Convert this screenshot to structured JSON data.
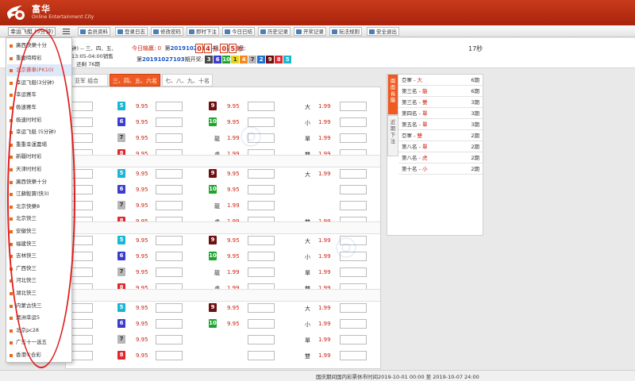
{
  "app": {
    "title": "富华",
    "subtitle": "Online Entertainment City"
  },
  "toolbar": {
    "lottery_select": "幸运飞艇 (5分钟)",
    "buttons": [
      "会员资料",
      "登录日志",
      "修改密码",
      "即时下注",
      "今日已结",
      "历史记录",
      "开奖记录",
      "玩法规则",
      "安全退出"
    ]
  },
  "info": {
    "partial_game": "钟) -- 三、四、五、",
    "time_range": "13:05-04:00销售",
    "remaining_draws": "还剩 76期",
    "today_result_label": "今日输赢:",
    "today_result_value": "0",
    "period_prefix": "第",
    "current_period": "20191027105",
    "period_suffix": "期, 距离封盘:",
    "countdown_digits": [
      "0",
      "4",
      "0",
      "5"
    ],
    "countdown_units": [
      "分",
      "秒"
    ],
    "last_draw_prefix": "第",
    "last_draw_period": "20191027103",
    "last_draw_suffix": "期开奖:",
    "last_draw_numbers": [
      "3",
      "6",
      "10",
      "1",
      "4",
      "7",
      "2",
      "9",
      "8",
      "5"
    ],
    "seconds_label": "17秒"
  },
  "colors": {
    "1": "#e6d51f",
    "2": "#1f74d6",
    "3": "#4a4a4a",
    "4": "#f28a20",
    "5": "#19b7d1",
    "6": "#3b3cce",
    "7": "#b7b7b7",
    "8": "#e0282c",
    "9": "#6d1010",
    "10": "#1ea52e"
  },
  "tabs": [
    "亚军 组合",
    "三、四、五、六名",
    "七、八、九、十名"
  ],
  "groups": [
    {
      "rows": [
        {
          "num": "5",
          "odds": "9.95",
          "num2": "9",
          "odds2": "9.95",
          "word": "大",
          "wodds": "1.99"
        },
        {
          "num": "6",
          "odds": "9.95",
          "num2": "10",
          "odds2": "9.95",
          "word": "小",
          "wodds": "1.99"
        },
        {
          "num": "7",
          "odds": "9.95",
          "word2": "龍",
          "odds2": "1.99",
          "word": "單",
          "wodds": "1.99"
        },
        {
          "num": "8",
          "odds": "9.95",
          "word2": "虎",
          "odds2": "1.99",
          "word": "雙",
          "wodds": "1.99"
        }
      ]
    },
    {
      "rows": [
        {
          "num": "5",
          "odds": "9.95",
          "num2": "9",
          "odds2": "9.95",
          "word": "大",
          "wodds": "1.99"
        },
        {
          "num": "6",
          "odds": "9.95",
          "num2": "10",
          "odds2": "9.95",
          "word": "",
          "wodds": ""
        },
        {
          "num": "7",
          "odds": "9.95",
          "word2": "龍",
          "odds2": "1.99",
          "word": "",
          "wodds": ""
        },
        {
          "num": "8",
          "odds": "9.95",
          "word2": "虎",
          "odds2": "1.99",
          "word": "雙",
          "wodds": "1.99"
        }
      ]
    },
    {
      "rows": [
        {
          "num": "5",
          "odds": "9.95",
          "num2": "9",
          "odds2": "9.95",
          "word": "大",
          "wodds": "1.99"
        },
        {
          "num": "6",
          "odds": "9.95",
          "num2": "10",
          "odds2": "9.95",
          "word": "小",
          "wodds": "1.99"
        },
        {
          "num": "7",
          "odds": "9.95",
          "word2": "龍",
          "odds2": "1.99",
          "word": "單",
          "wodds": "1.99"
        },
        {
          "num": "8",
          "odds": "9.95",
          "word2": "虎",
          "odds2": "1.99",
          "word": "雙",
          "wodds": "1.99"
        }
      ]
    },
    {
      "rows": [
        {
          "num": "5",
          "odds": "9.95",
          "num2": "9",
          "odds2": "9.95",
          "word": "大",
          "wodds": "1.99"
        },
        {
          "num": "6",
          "odds": "9.95",
          "num2": "10",
          "odds2": "9.95",
          "word": "小",
          "wodds": "1.99"
        },
        {
          "num": "7",
          "odds": "9.95",
          "word2": "",
          "odds2": "",
          "word": "單",
          "wodds": "1.99"
        },
        {
          "num": "8",
          "odds": "9.95",
          "word2": "",
          "odds2": "",
          "word": "雙",
          "wodds": "1.99"
        }
      ]
    }
  ],
  "dragon": {
    "tab_long": "兩面長龍",
    "tab_recent": "近期下注",
    "rows": [
      {
        "name": "亞軍 - ",
        "value": "大",
        "count": "6期"
      },
      {
        "name": "第三名 - ",
        "value": "龍",
        "count": "6期"
      },
      {
        "name": "第三名 - ",
        "value": "雙",
        "count": "3期"
      },
      {
        "name": "第四名 - ",
        "value": "單",
        "count": "3期"
      },
      {
        "name": "第五名 - ",
        "value": "單",
        "count": "3期"
      },
      {
        "name": "亞軍 - ",
        "value": "雙",
        "count": "2期"
      },
      {
        "name": "第八名 - ",
        "value": "單",
        "count": "2期"
      },
      {
        "name": "第八名 - ",
        "value": "虎",
        "count": "2期"
      },
      {
        "name": "第十名 - ",
        "value": "小",
        "count": "2期"
      }
    ]
  },
  "dropdown": [
    "廣西快樂十分",
    "重慶時時彩",
    "北京賽車(PK10)",
    "幸运飞艇(3分钟)",
    "幸运赛车",
    "极速赛车",
    "极速时时彩",
    "幸运飞艇 (5分钟)",
    "重重幸運農場",
    "新疆时时彩",
    "天津时时彩",
    "廣西快樂十分",
    "江蘇骰寶(快3)",
    "北京快樂8",
    "北京快三",
    "安徽快三",
    "福建快三",
    "吉林快三",
    "广西快三",
    "河北快三",
    "湖北快三",
    "内蒙古快三",
    "澳洲幸运5",
    "北京pc28",
    "广东十一选五",
    "香港⑥合彩"
  ],
  "footer": "国庆期间国内彩票休市时间2019-10-01 00:00 至 2019-10-07 24:00"
}
